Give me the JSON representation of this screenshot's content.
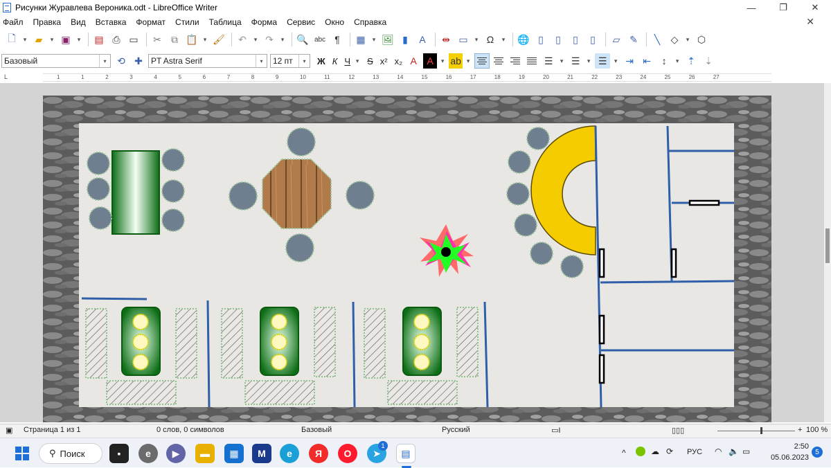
{
  "window": {
    "title": "Рисунки Журавлева Вероника.odt - LibreOffice Writer"
  },
  "menu": [
    "Файл",
    "Правка",
    "Вид",
    "Вставка",
    "Формат",
    "Стили",
    "Таблица",
    "Форма",
    "Сервис",
    "Окно",
    "Справка"
  ],
  "format_bar": {
    "paragraph_style": "Базовый",
    "font_name": "PT Astra Serif",
    "font_size": "12 пт",
    "bold": "Ж",
    "italic": "К",
    "underline": "Ч",
    "strike": "S",
    "superscript": "x²",
    "subscript": "x₂"
  },
  "ruler": [
    "1",
    "1",
    "2",
    "3",
    "4",
    "5",
    "6",
    "7",
    "8",
    "9",
    "10",
    "11",
    "12",
    "13",
    "14",
    "15",
    "16",
    "17",
    "18",
    "19",
    "20",
    "21",
    "22",
    "23",
    "24",
    "25",
    "26",
    "27"
  ],
  "status": {
    "page": "Страница 1 из 1",
    "words": "0 слов, 0 символов",
    "style": "Базовый",
    "language": "Русский",
    "zoom": "100 %"
  },
  "taskbar": {
    "search": "Поиск",
    "lang": "РУС",
    "time": "2:50",
    "date": "05.06.2023",
    "notifications": "5",
    "telegram_badge": "1",
    "yandex": "Я"
  },
  "colors": {
    "accent": "#2a6ac8",
    "wall_blue": "#2e5fa8",
    "table_green": "#0f7a1a",
    "chair_gray": "#6f7f8f",
    "yellow_counter": "#f5cc00",
    "floor": "#e8e6e3"
  }
}
